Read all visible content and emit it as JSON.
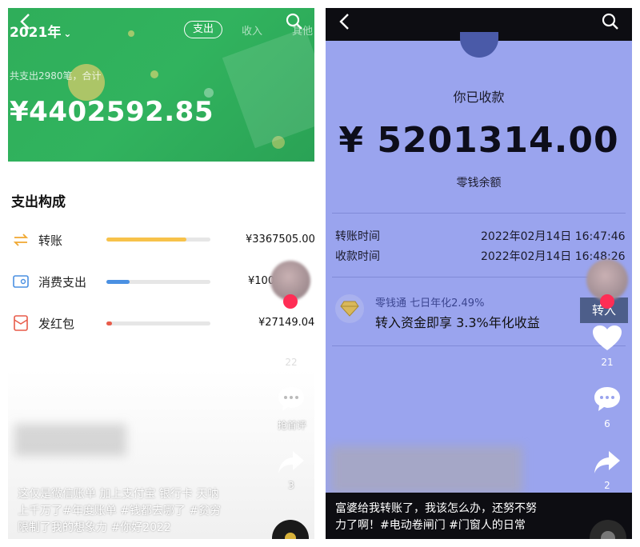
{
  "left": {
    "header": {
      "year_label": "2021年",
      "tab_expense": "支出",
      "tab_income": "收入",
      "tab_other": "其他"
    },
    "summary_text": "共支出2980笔，合计",
    "total_amount": "¥4402592.85",
    "section_title": "支出构成",
    "categories": [
      {
        "label": "转账",
        "amount": "¥3367505.00",
        "bar_fraction": 0.77,
        "color": "#f7c24a",
        "icon": "transfer-icon"
      },
      {
        "label": "消费支出",
        "amount": "¥100",
        "bar_fraction": 0.22,
        "color": "#4a90e2",
        "icon": "card-icon"
      },
      {
        "label": "发红包",
        "amount": "¥27149.04",
        "bar_fraction": 0.03,
        "color": "#e85c4a",
        "icon": "red-packet-icon"
      }
    ],
    "side": {
      "like_count": "22",
      "comment_label": "抢首评",
      "share_count": "3"
    },
    "caption_lines": [
      "这仅是微信账单 加上支付宝 银行卡 天呐",
      "上千万了#年度账单 #钱都去哪了 #贫穷",
      "限制了我的想象力 #你好2022"
    ]
  },
  "right": {
    "received_label": "你已收款",
    "amount": "¥ 5201314.00",
    "balance_label": "零钱余额",
    "transfer_time_label": "转账时间",
    "transfer_time_value": "2022年02月14日 16:47:46",
    "receive_time_label": "收款时间",
    "receive_time_value": "2022年02月14日 16:48:26",
    "promo_title": "零钱通 七日年化2.49%",
    "promo_text": "转入资金即享 3.3%年化收益",
    "transfer_in_button": "转入",
    "side": {
      "like_count": "21",
      "comment_count": "6",
      "share_count": "2"
    },
    "caption_lines": [
      "富婆给我转账了，我该怎么办，还努不努",
      "力了啊！#电动卷闸门 #门窗人的日常"
    ]
  }
}
